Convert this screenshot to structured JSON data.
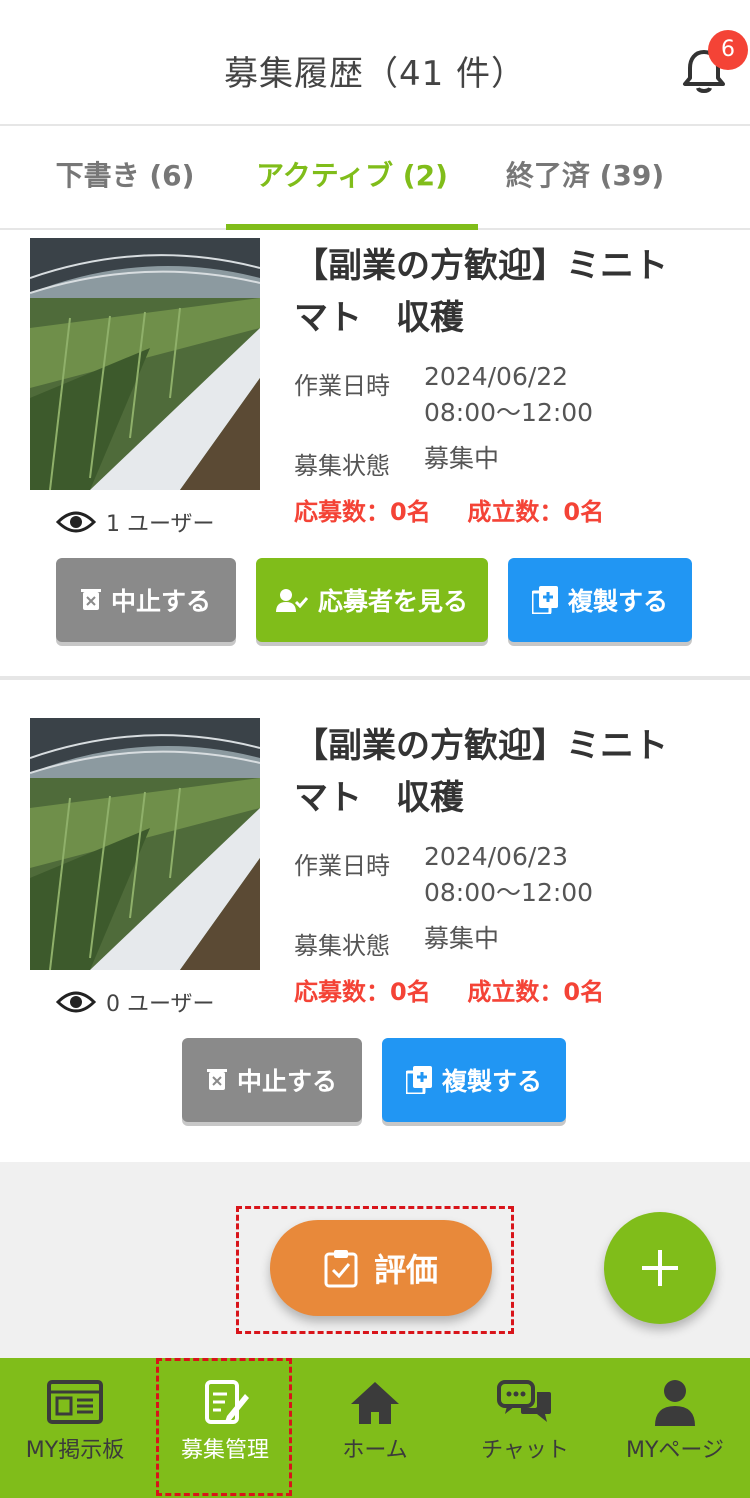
{
  "header": {
    "title": "募集履歴（41 件）",
    "notification_count": "6"
  },
  "tabs": [
    {
      "label": "下書き (6)"
    },
    {
      "label": "アクティブ (2)"
    },
    {
      "label": "終了済 (39)"
    }
  ],
  "posts": [
    {
      "title_line1": "【副業の方歓迎】ミニト",
      "title_line2": "マト　収穫",
      "work_date_label": "作業日時",
      "work_date": "2024/06/22",
      "work_time": "08:00〜12:00",
      "status_label": "募集状態",
      "status": "募集中",
      "applications": "応募数：0名",
      "matches": "成立数：0名",
      "views": "1 ユーザー",
      "buttons": {
        "cancel": "中止する",
        "view_applicants": "応募者を見る",
        "duplicate": "複製する"
      }
    },
    {
      "title_line1": "【副業の方歓迎】ミニト",
      "title_line2": "マト　収穫",
      "work_date_label": "作業日時",
      "work_date": "2024/06/23",
      "work_time": "08:00〜12:00",
      "status_label": "募集状態",
      "status": "募集中",
      "applications": "応募数：0名",
      "matches": "成立数：0名",
      "views": "0 ユーザー",
      "buttons": {
        "cancel": "中止する",
        "duplicate": "複製する"
      }
    }
  ],
  "evaluate_button": "評価",
  "nav": [
    {
      "label": "MY掲示板",
      "icon": "bulletin-board-icon"
    },
    {
      "label": "募集管理",
      "icon": "recruit-manage-icon"
    },
    {
      "label": "ホーム",
      "icon": "home-icon"
    },
    {
      "label": "チャット",
      "icon": "chat-icon"
    },
    {
      "label": "MYページ",
      "icon": "user-icon"
    }
  ],
  "colors": {
    "accent_green": "#80bd1a",
    "blue": "#2196f3",
    "gray": "#8a8a8a",
    "orange": "#e8893a",
    "red": "#f44336"
  }
}
